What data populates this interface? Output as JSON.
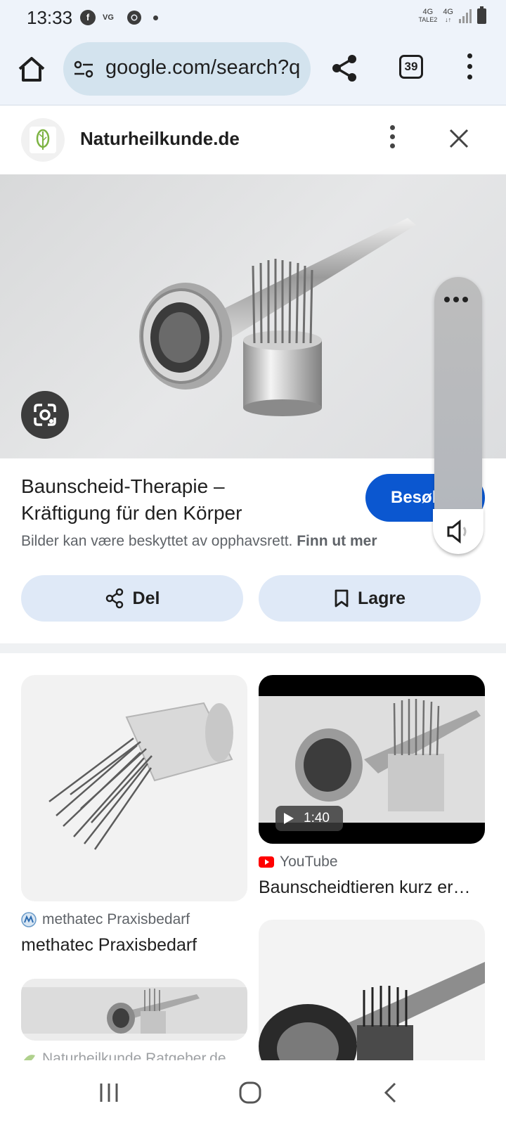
{
  "status_bar": {
    "time": "13:33",
    "left_icons": [
      "f",
      "VG"
    ],
    "network_1": "4G",
    "network_1_sub": "TALE2",
    "network_2": "4G",
    "network_2_sub": "↓↑"
  },
  "browser": {
    "url": "google.com/search?q",
    "tab_count": "39"
  },
  "site": {
    "name": "Naturheilkunde.de"
  },
  "result": {
    "title_line1": "Baunscheid-Therapie –",
    "title_line2": "Kräftigung für den Körper",
    "visit_label": "Besøk",
    "copyright_text": "Bilder kan være beskyttet av opphavsrett.",
    "learn_more": "Finn ut mer",
    "share_label": "Del",
    "save_label": "Lagre"
  },
  "grid": {
    "card1": {
      "source": "methatec Praxisbedarf",
      "title": "methatec Praxisbedarf"
    },
    "card2": {
      "source": "YouTube",
      "title": "Baunscheidtieren kurz er…",
      "duration": "1:40"
    },
    "card3": {
      "source": "Naturheilkunde Ratgeber.de"
    }
  },
  "colors": {
    "accent": "#0b57d0",
    "chip": "#dfe9f7",
    "toolbar": "#eef3fa",
    "youtube": "#ff0000"
  }
}
